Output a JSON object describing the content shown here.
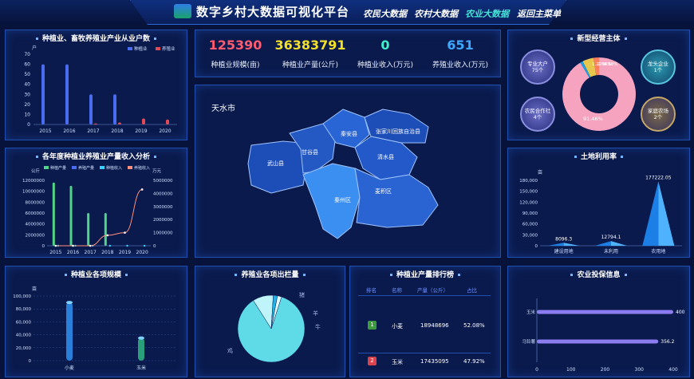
{
  "header": {
    "title": "数字乡村大数据可视化平台",
    "nav": [
      "农民大数据",
      "农村大数据",
      "农业大数据",
      "返回主菜单"
    ],
    "active_nav": "农业大数据"
  },
  "stats": [
    {
      "value": "125390",
      "label": "种植业规模(亩)",
      "color": "#ff5a6e"
    },
    {
      "value": "36383791",
      "label": "种植业产量(公斤)",
      "color": "#f2df2a"
    },
    {
      "value": "0",
      "label": "种植业收入(万元)",
      "color": "#3ff0c8"
    },
    {
      "value": "651",
      "label": "养殖业收入(万元)",
      "color": "#3da8ff"
    }
  ],
  "panels": {
    "p1_title": "种植业、畜牧养殖业产业从业户数",
    "p2_title": "各年度种植业养殖业产量收入分析",
    "p3_title": "种植业各项规模",
    "map_title": "天水市",
    "p5_title": "养殖业各项出栏量",
    "p6_title": "种植业产量排行榜",
    "p7_title": "新型经营主体",
    "p8_title": "土地利用率",
    "p9_title": "农业投保信息"
  },
  "map_regions": [
    "秦安县",
    "张家川回族自治县",
    "甘谷县",
    "清水县",
    "武山县",
    "秦州区",
    "麦积区"
  ],
  "chart_data": [
    {
      "id": "households",
      "type": "bar",
      "title": "种植业、畜牧养殖业产业从业户数",
      "ylabel": "户",
      "ylim": [
        0,
        70
      ],
      "yticks": [
        0,
        10,
        20,
        30,
        40,
        50,
        60,
        70
      ],
      "categories": [
        "2015",
        "2016",
        "2017",
        "2018",
        "2019",
        "2020"
      ],
      "legend": [
        "种植业",
        "养殖业"
      ],
      "series": [
        {
          "name": "种植业",
          "values": [
            60,
            60,
            30,
            30,
            0,
            0
          ],
          "color": "#4a6cf0"
        },
        {
          "name": "养殖业",
          "values": [
            0,
            0,
            1,
            2,
            6,
            5
          ],
          "color": "#e24a55"
        }
      ]
    },
    {
      "id": "yield_income",
      "type": "bar+line",
      "title": "各年度种植业养殖业产量收入分析",
      "ylabel_left": "公斤",
      "ylabel_right": "万元",
      "ylim_left": [
        0,
        12000000
      ],
      "yticks_left": [
        "0",
        "2000000",
        "4000000",
        "6000000",
        "8000000",
        "10000000",
        "12000000"
      ],
      "ylim_right": [
        0,
        5000000
      ],
      "yticks_right": [
        "0",
        "1000000",
        "2000000",
        "3000000",
        "4000000",
        "5000000"
      ],
      "categories": [
        "2015",
        "2016",
        "2017",
        "2018",
        "2019",
        "2020"
      ],
      "legend": [
        "种植产量",
        "养殖产量",
        "种植收入",
        "养殖收入"
      ],
      "series": [
        {
          "name": "种植产量",
          "values": [
            11600000,
            11000000,
            6000000,
            6000000,
            0,
            0
          ],
          "color": "#4fd48a"
        },
        {
          "name": "养殖产量",
          "values": [
            0,
            0,
            0,
            0,
            0,
            0
          ],
          "color": "#4a6cf0"
        },
        {
          "name": "种植收入",
          "values": [
            0,
            0,
            0,
            0,
            0,
            0
          ],
          "color": "#3ad0ff"
        },
        {
          "name": "养殖收入",
          "values": [
            0,
            0,
            0,
            800000,
            1000000,
            4300000
          ],
          "color": "#ff8f7a"
        }
      ]
    },
    {
      "id": "planting_scale",
      "type": "bar",
      "title": "种植业各项规模",
      "ylabel": "亩",
      "ylim": [
        0,
        100000
      ],
      "yticks": [
        "0",
        "20,000",
        "40,000",
        "60,000",
        "80,000",
        "100,000"
      ],
      "categories": [
        "小麦",
        "玉米"
      ],
      "values": [
        90000,
        35000
      ],
      "colors": [
        "#2a7fd8",
        "#2aa07a"
      ]
    },
    {
      "id": "livestock",
      "type": "pie",
      "title": "养殖业各项出栏量",
      "labels": [
        "鸡",
        "猪",
        "羊",
        "牛"
      ],
      "values": [
        86,
        10,
        2,
        2
      ],
      "colors": [
        "#5fdbe8",
        "#bff4fb",
        "#23b2e8",
        "#e3fbff"
      ]
    },
    {
      "id": "ranking",
      "type": "table",
      "title": "种植业产量排行榜",
      "headers": [
        "排名",
        "名称",
        "产量（公斤）",
        "占比"
      ],
      "rows": [
        {
          "rank": "1",
          "name": "小麦",
          "output": "18948696",
          "share": "52.08%"
        },
        {
          "rank": "2",
          "name": "玉米",
          "output": "17435095",
          "share": "47.92%"
        }
      ]
    },
    {
      "id": "new_entities",
      "type": "pie",
      "title": "新型经营主体",
      "labels": [
        "专业大户",
        "龙头企业",
        "农民合作社",
        "家庭农场"
      ],
      "counts": [
        "75个",
        "1个",
        "4个",
        "2个"
      ],
      "values": [
        91.46,
        1.22,
        4.88,
        2.44
      ],
      "shown_labels": [
        "91.46%",
        "1.22%",
        "2.44%",
        "4.88%"
      ],
      "colors": [
        "#f6a3c0",
        "#1f9de0",
        "#e7c74b",
        "#ff7e5c"
      ]
    },
    {
      "id": "land_use",
      "type": "bar",
      "title": "土地利用率",
      "ylabel": "亩",
      "ylim": [
        0,
        180000
      ],
      "yticks": [
        "0",
        "30,000",
        "60,000",
        "90,000",
        "120,000",
        "150,000",
        "180,000"
      ],
      "categories": [
        "建设用地",
        "未利用",
        "农用地"
      ],
      "values": [
        8096.3,
        12794.1,
        177222.05
      ],
      "value_labels": [
        "8096.3",
        "12794.1",
        "177222.05"
      ]
    },
    {
      "id": "insurance",
      "type": "bar",
      "title": "农业投保信息",
      "orientation": "horizontal",
      "categories": [
        "玉米",
        "马铃薯"
      ],
      "values": [
        400,
        356.2
      ],
      "value_labels": [
        "400",
        "356.2"
      ],
      "xlim": [
        0,
        400
      ],
      "xticks": [
        "0",
        "100",
        "200",
        "300",
        "400"
      ]
    }
  ]
}
